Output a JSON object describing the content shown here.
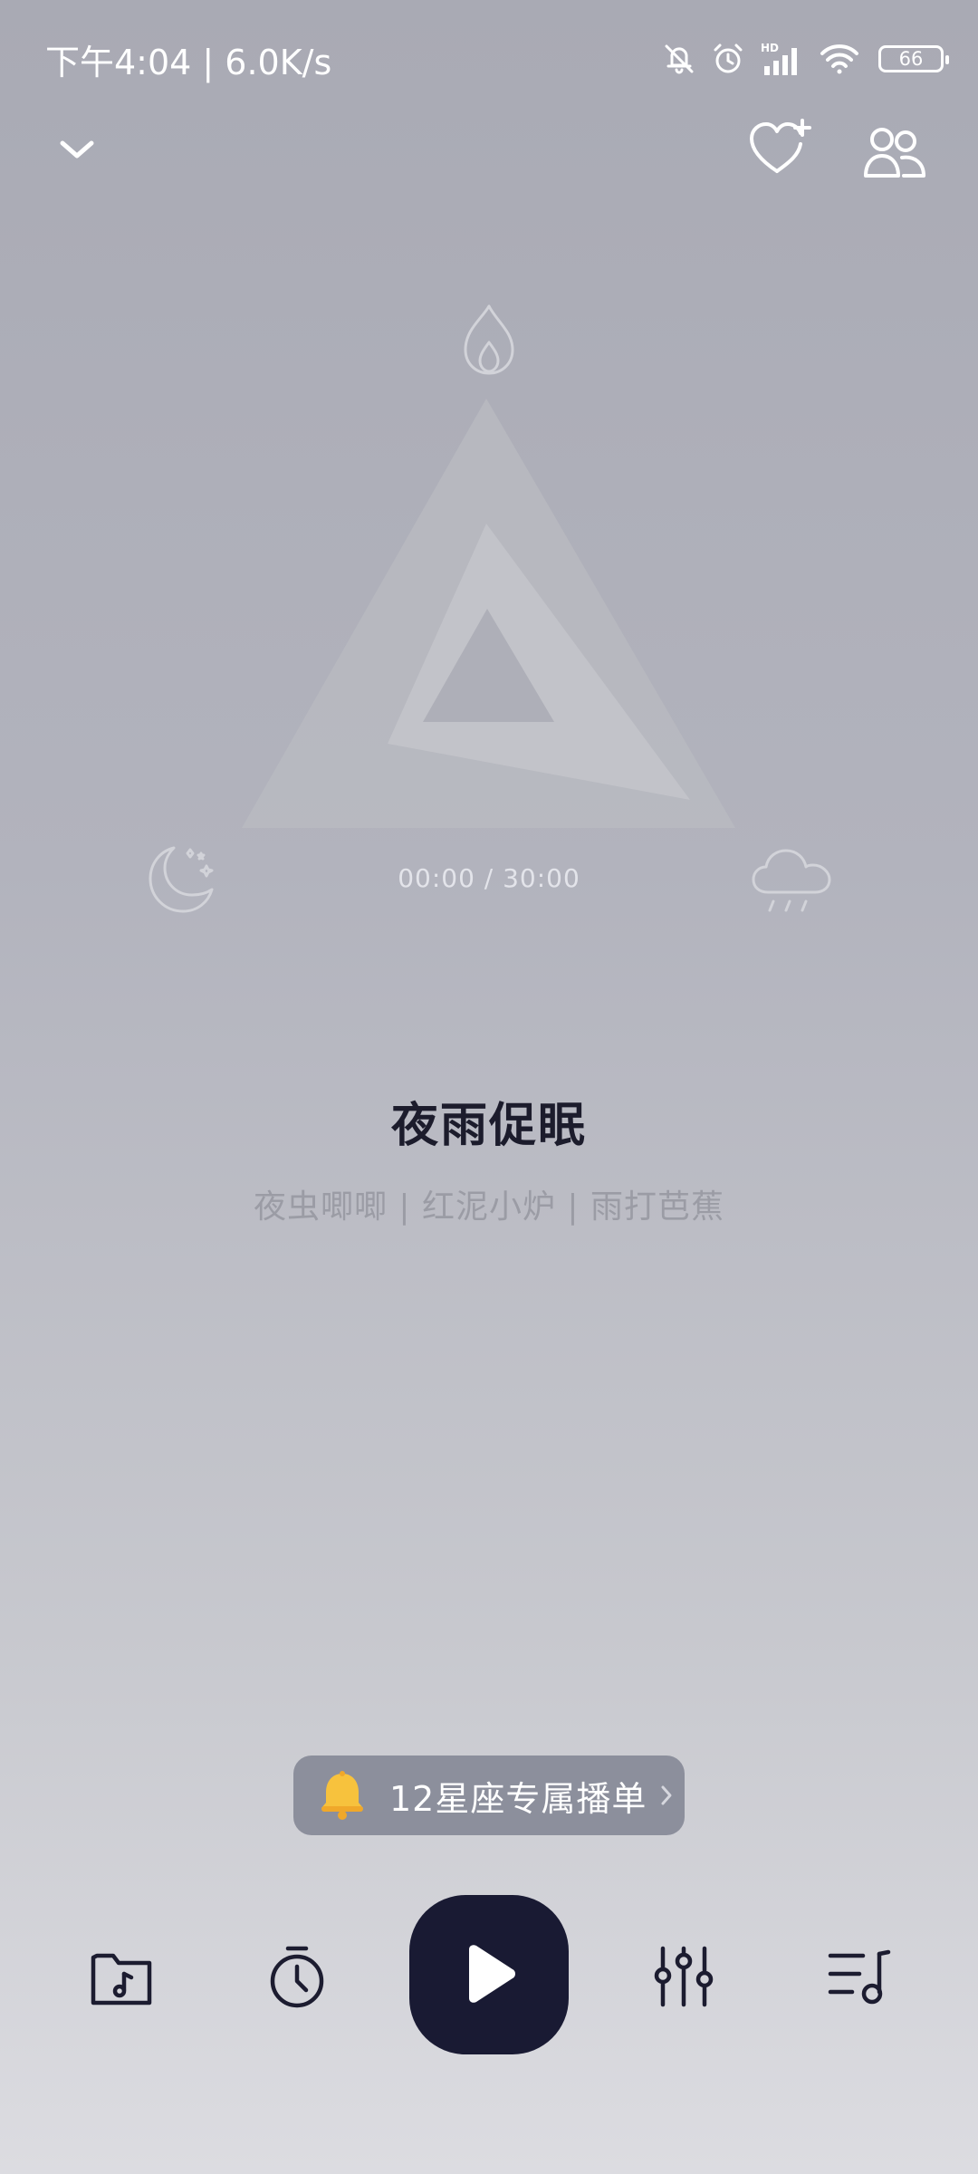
{
  "status_bar": {
    "time_speed": "下午4:04 | 6.0K/s",
    "network_label": "HD",
    "battery_level": "66"
  },
  "header": {
    "collapse_icon": "chevron-down-icon",
    "favorite_icon": "heart-plus-icon",
    "share_icon": "users-icon"
  },
  "visual": {
    "top_icon": "flame-icon",
    "left_icon": "moon-stars-icon",
    "right_icon": "rain-cloud-icon"
  },
  "player": {
    "time_readout": "00:00 / 30:00",
    "title": "夜雨促眠",
    "subtitle": "夜虫唧唧 | 红泥小炉 | 雨打芭蕉"
  },
  "promo": {
    "label": "12星座专属播单",
    "icon": "bell-icon"
  },
  "controls": {
    "items": [
      "music-folder-icon",
      "timer-icon",
      "play-icon",
      "equalizer-icon",
      "playlist-icon"
    ]
  },
  "colors": {
    "accent_dark": "#191a33",
    "promo_bg": "#8c8f9c",
    "bell": "#f5b731"
  }
}
